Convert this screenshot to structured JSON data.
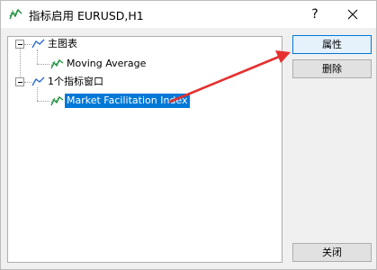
{
  "window": {
    "title": "指标启用 EURUSD,H1",
    "help_glyph": "?",
    "close_glyph": "✕"
  },
  "tree": {
    "nodes": [
      {
        "label": "主图表",
        "icon": "chart-window-icon",
        "level": 0
      },
      {
        "label": "Moving Average",
        "icon": "indicator-icon",
        "level": 1
      },
      {
        "label": "1个指标窗口",
        "icon": "chart-window-icon",
        "level": 0
      },
      {
        "label": "Market Facilitation Index",
        "icon": "indicator-icon",
        "level": 1,
        "selected": true
      }
    ]
  },
  "buttons": {
    "properties": "属性",
    "delete": "删除",
    "close": "关闭"
  },
  "colors": {
    "selection": "#0078d7",
    "annotation_arrow": "#e5302f",
    "indicator_icon": "#1a8f3a",
    "chart_icon": "#2266cc"
  }
}
